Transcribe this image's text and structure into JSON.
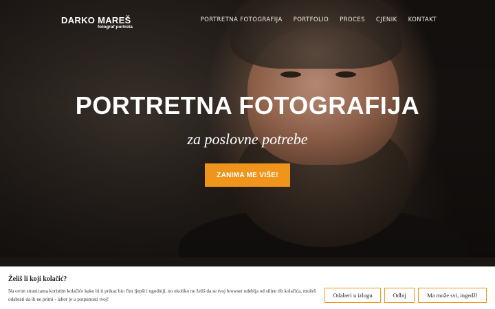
{
  "brand": {
    "name": "DARKO MAREŠ",
    "tagline": "fotograf portreta"
  },
  "nav": {
    "items": [
      {
        "label": "PORTRETNA FOTOGRAFIJA"
      },
      {
        "label": "PORTFOLIO"
      },
      {
        "label": "PROCES"
      },
      {
        "label": "CJENIK"
      },
      {
        "label": "KONTAKT"
      }
    ]
  },
  "hero": {
    "title": "PORTRETNA FOTOGRAFIJA",
    "subtitle": "za poslovne potrebe",
    "cta_label": "ZANIMA ME VIŠE!",
    "image": "portrait-photo-bearded-man"
  },
  "cookie_banner": {
    "title": "Želiš li koji kolačić?",
    "text": "Na ovim stranicama koristim kolačiće kako bi ti prikaz bio čim ljepši i ugodniji, no ukoliko ne želiš da se tvoj browser udeblja od siline tih kolačića, možeš odabrati da ih ne primi - izbor je u potpunosti tvoj!",
    "buttons": {
      "select": "Odaberi u izlogu",
      "reject": "Odbij",
      "accept_all": "Ma može svi, ingedž!"
    }
  },
  "colors": {
    "accent": "#f0951c",
    "text_light": "#ffffff",
    "banner_bg": "#ffffff"
  }
}
